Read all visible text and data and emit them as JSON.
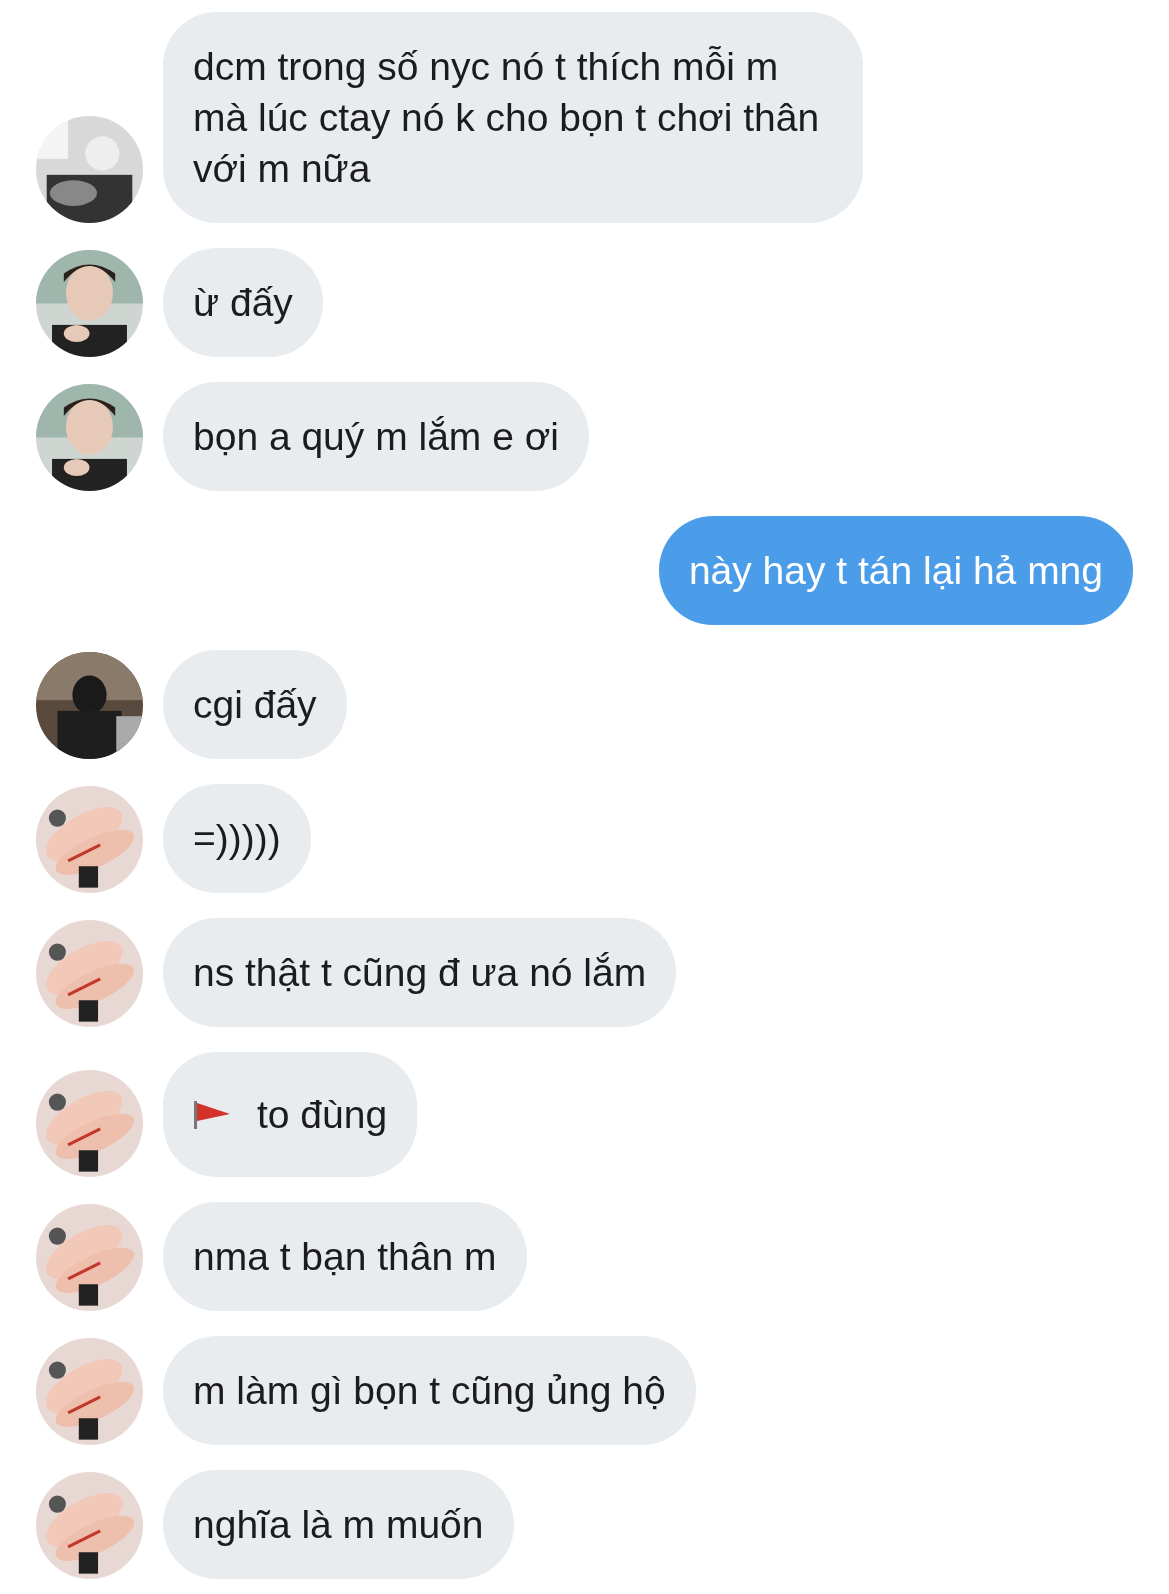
{
  "messages": [
    {
      "kind": "incoming",
      "text": "dcm trong số nyc nó t thích mỗi m mà lúc ctay nó k cho bọn t chơi thân với m nữa"
    },
    {
      "kind": "incoming",
      "text": "ừ đấy"
    },
    {
      "kind": "incoming",
      "text": "bọn a quý m lắm e ơi"
    },
    {
      "kind": "outgoing",
      "text": "này hay t tán lại hả mng"
    },
    {
      "kind": "incoming",
      "text": "cgi đấy"
    },
    {
      "kind": "incoming",
      "text": "=)))))"
    },
    {
      "kind": "incoming",
      "text": "ns thật t cũng đ ưa nó lắm"
    },
    {
      "kind": "flag",
      "text": "to đùng"
    },
    {
      "kind": "incoming",
      "text": "nma t bạn thân m"
    },
    {
      "kind": "incoming",
      "text": "m làm gì bọn t cũng ủng hộ"
    },
    {
      "kind": "incoming",
      "text": "nghĩa là m muốn"
    }
  ]
}
